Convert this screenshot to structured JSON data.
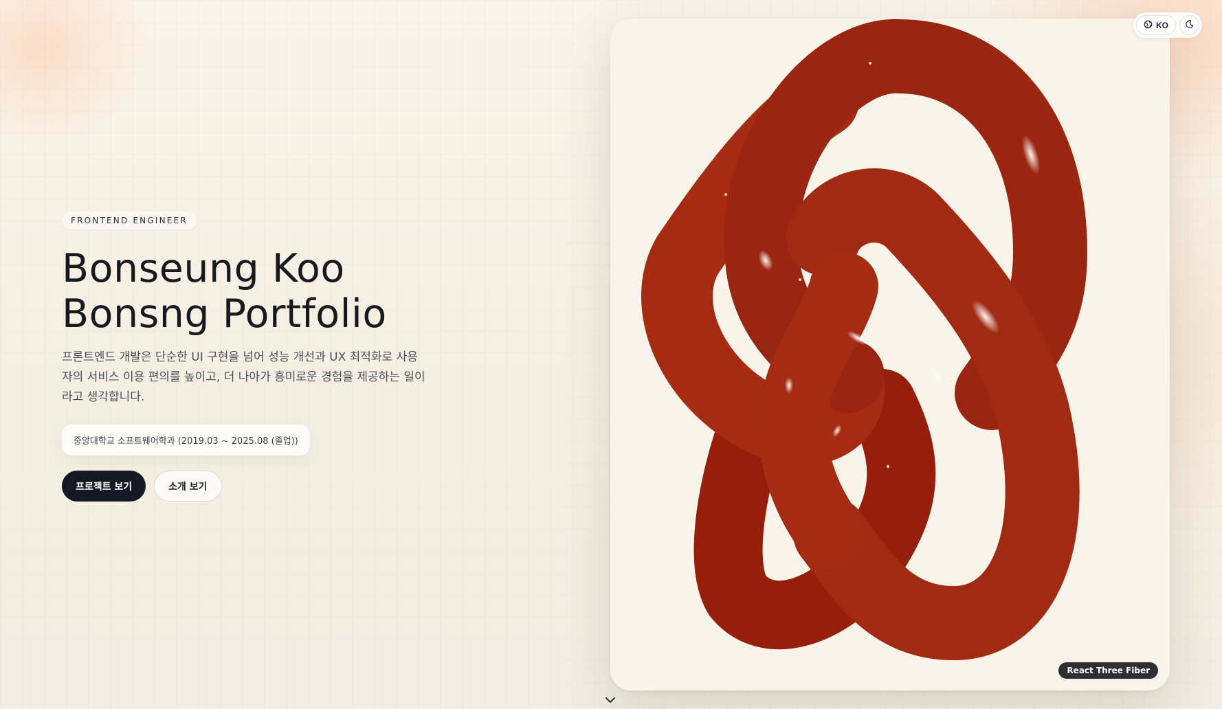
{
  "hero": {
    "eyebrow": "FRONTEND ENGINEER",
    "title_line1": "Bonseung Koo",
    "title_line2": "Bonsng Portfolio",
    "description": "프론트엔드 개발은 단순한 UI 구현을 넘어 성능 개선과 UX 최적화로 사용자의 서비스 이용 편의를 높이고, 더 나아가 흥미로운 경험을 제공하는 일이라고 생각합니다.",
    "education": "중앙대학교 소프트웨어학과 (2019.03 ~ 2025.08 (졸업))",
    "primary_button": "프로젝트 보기",
    "secondary_button": "소개 보기"
  },
  "visual": {
    "badge": "React Three Fiber",
    "knot_color": "#a52c12"
  },
  "controls": {
    "language": "KO",
    "language_icon": "globe-icon",
    "theme_icon": "moon-icon"
  },
  "scroll_icon": "chevron-down-icon",
  "colors": {
    "background": "#f6efe4",
    "accent": "#a52c12",
    "primary_button": "#141923"
  }
}
